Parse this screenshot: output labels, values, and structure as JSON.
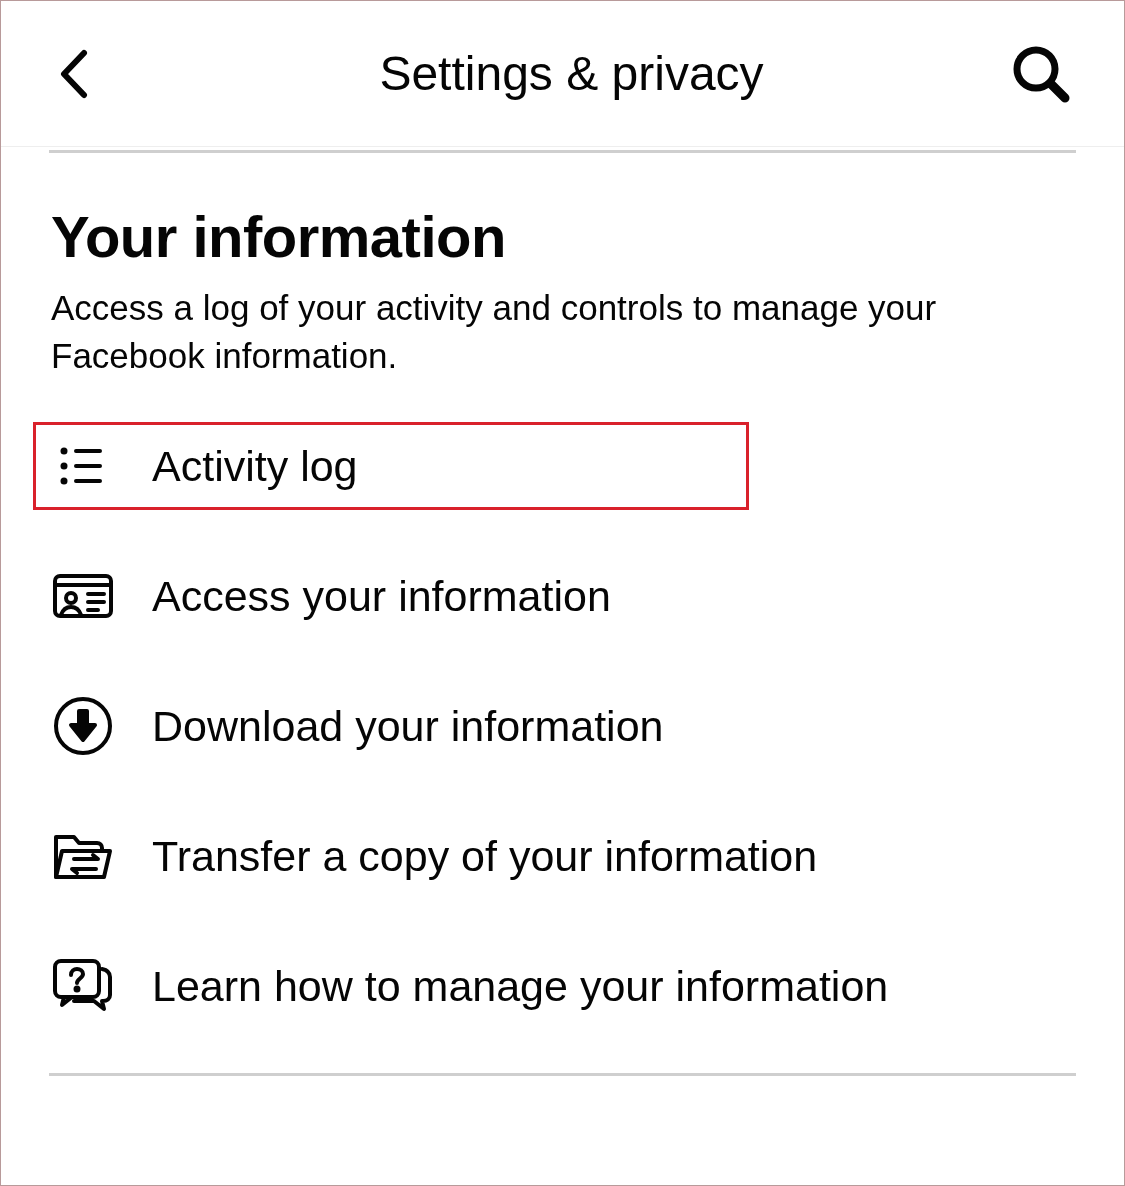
{
  "header": {
    "title": "Settings & privacy"
  },
  "section": {
    "title": "Your information",
    "description": "Access a log of your activity and controls to manage your Facebook information."
  },
  "items": [
    {
      "kind": "list",
      "label": "Activity log",
      "highlighted": true
    },
    {
      "kind": "card",
      "label": "Access your information",
      "highlighted": false
    },
    {
      "kind": "download",
      "label": "Download your information",
      "highlighted": false
    },
    {
      "kind": "transfer",
      "label": "Transfer a copy of your information",
      "highlighted": false
    },
    {
      "kind": "help",
      "label": "Learn how to manage your information",
      "highlighted": false
    }
  ]
}
